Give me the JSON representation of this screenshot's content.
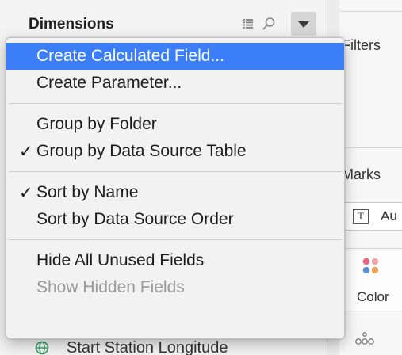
{
  "data_pane": {
    "title": "Dimensions",
    "bottom_field": "Start Station Longitude"
  },
  "shelves": {
    "filters_title": "Filters",
    "marks_title": "Marks",
    "mark_type_label": "Au",
    "mark_type_icon_glyph": "T",
    "color_label": "Color"
  },
  "menu": {
    "groups": [
      [
        {
          "label": "Create Calculated Field...",
          "checked": false,
          "highlighted": true,
          "enabled": true
        },
        {
          "label": "Create Parameter...",
          "checked": false,
          "highlighted": false,
          "enabled": true
        }
      ],
      [
        {
          "label": "Group by Folder",
          "checked": false,
          "highlighted": false,
          "enabled": true
        },
        {
          "label": "Group by Data Source Table",
          "checked": true,
          "highlighted": false,
          "enabled": true
        }
      ],
      [
        {
          "label": "Sort by Name",
          "checked": true,
          "highlighted": false,
          "enabled": true
        },
        {
          "label": "Sort by Data Source Order",
          "checked": false,
          "highlighted": false,
          "enabled": true
        }
      ],
      [
        {
          "label": "Hide All Unused Fields",
          "checked": false,
          "highlighted": false,
          "enabled": true
        },
        {
          "label": "Show Hidden Fields",
          "checked": false,
          "highlighted": false,
          "enabled": false
        }
      ]
    ],
    "check_glyph": "✓"
  },
  "colors": {
    "highlight": "#3c7ef7",
    "disabled_text": "#9a9a9a",
    "color_dots": [
      "#e8647a",
      "#f2a5a8",
      "#5b8fd6",
      "#f0a35a"
    ]
  }
}
